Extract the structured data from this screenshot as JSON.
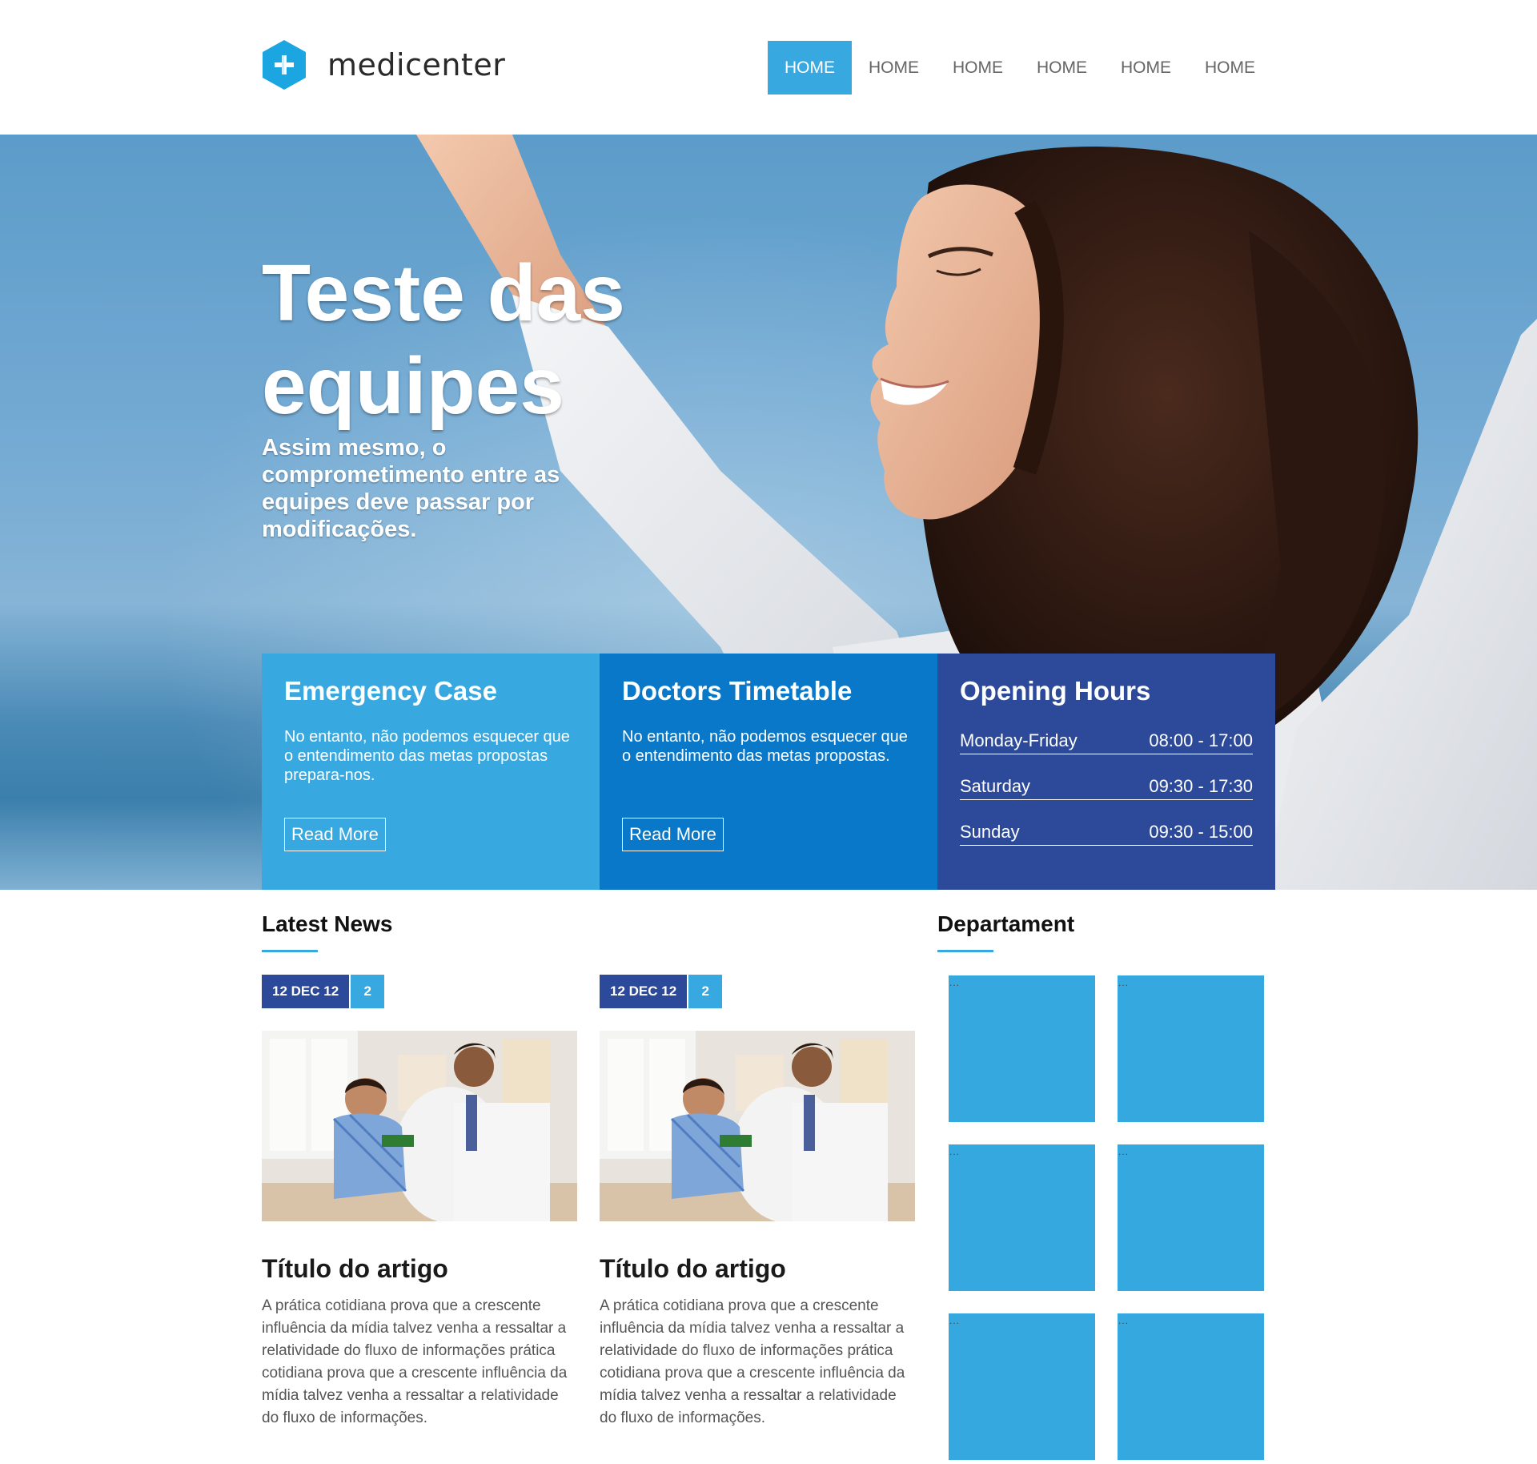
{
  "brand": {
    "name": "medicenter",
    "accent": "#38a8e0",
    "logo_icon": "plus-hexagon-icon"
  },
  "nav": {
    "items": [
      "HOME",
      "HOME",
      "HOME",
      "HOME",
      "HOME",
      "HOME"
    ],
    "active_index": 0
  },
  "hero": {
    "title": "Teste das equipes",
    "subtitle": "Assim mesmo, o comprometimento entre as equipes deve passar por modificações."
  },
  "info_boxes": {
    "emergency": {
      "title": "Emergency Case",
      "text": "No entanto, não podemos esquecer que o entendimento das metas propostas prepara-nos.",
      "button": "Read More",
      "color": "#38a8e0"
    },
    "doctors": {
      "title": "Doctors Timetable",
      "text": "No entanto, não podemos esquecer que o entendimento das metas propostas.",
      "button": "Read More",
      "color": "#0a78c8"
    },
    "hours": {
      "title": "Opening Hours",
      "color": "#2d4a9a",
      "rows": [
        {
          "day": "Monday-Friday",
          "time": "08:00 - 17:00"
        },
        {
          "day": "Saturday",
          "time": "09:30 - 17:30"
        },
        {
          "day": "Sunday",
          "time": "09:30 - 15:00"
        }
      ]
    }
  },
  "news": {
    "heading": "Latest News",
    "cards": [
      {
        "date": "12 DEC 12",
        "comments": "2",
        "title": "Título do artigo",
        "text": "A prática cotidiana prova que a crescente influência da mídia talvez venha a ressaltar a relatividade do fluxo de informações prática cotidiana prova que a crescente influência da mídia talvez venha a ressaltar a relatividade do fluxo de informações."
      },
      {
        "date": "12 DEC 12",
        "comments": "2",
        "title": "Título do artigo",
        "text": "A prática cotidiana prova que a crescente influência da mídia talvez venha a ressaltar a relatividade do fluxo de informações prática cotidiana prova que a crescente influência da mídia talvez venha a ressaltar a relatividade do fluxo de informações."
      }
    ]
  },
  "department": {
    "heading": "Departament",
    "tiles": [
      "...",
      "...",
      "...",
      "...",
      "...",
      "..."
    ],
    "tile_color": "#36a8e0"
  }
}
